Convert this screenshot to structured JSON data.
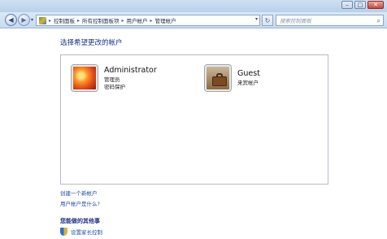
{
  "window": {
    "min_glyph": "–",
    "max_glyph": "□",
    "close_glyph": "✕"
  },
  "nav": {
    "back_glyph": "◀",
    "forward_glyph": "▶",
    "dropdown_glyph": "▾",
    "breadcrumb": [
      "控制面板",
      "所有控制面板项",
      "用户帐户",
      "管理帐户"
    ],
    "separator": "▸",
    "refresh_glyph": "↻",
    "search_placeholder": "搜索控制面板",
    "search_icon_glyph": "⌕"
  },
  "main": {
    "title": "选择希望更改的帐户",
    "accounts": [
      {
        "name": "Administrator",
        "lines": [
          "管理员",
          "密码保护"
        ],
        "icon": "flower-avatar-icon"
      },
      {
        "name": "Guest",
        "lines": [
          "来宾帐户"
        ],
        "icon": "briefcase-avatar-icon"
      }
    ],
    "links": {
      "create_account": "创建一个新帐户",
      "what_is_account": "用户帐户是什么?"
    },
    "other_tasks_heading": "您能做的其他事",
    "parental_control": "设置家长控制"
  },
  "colors": {
    "link": "#1f4ea3",
    "heading": "#1e3287",
    "chrome": "#c8dbef"
  }
}
